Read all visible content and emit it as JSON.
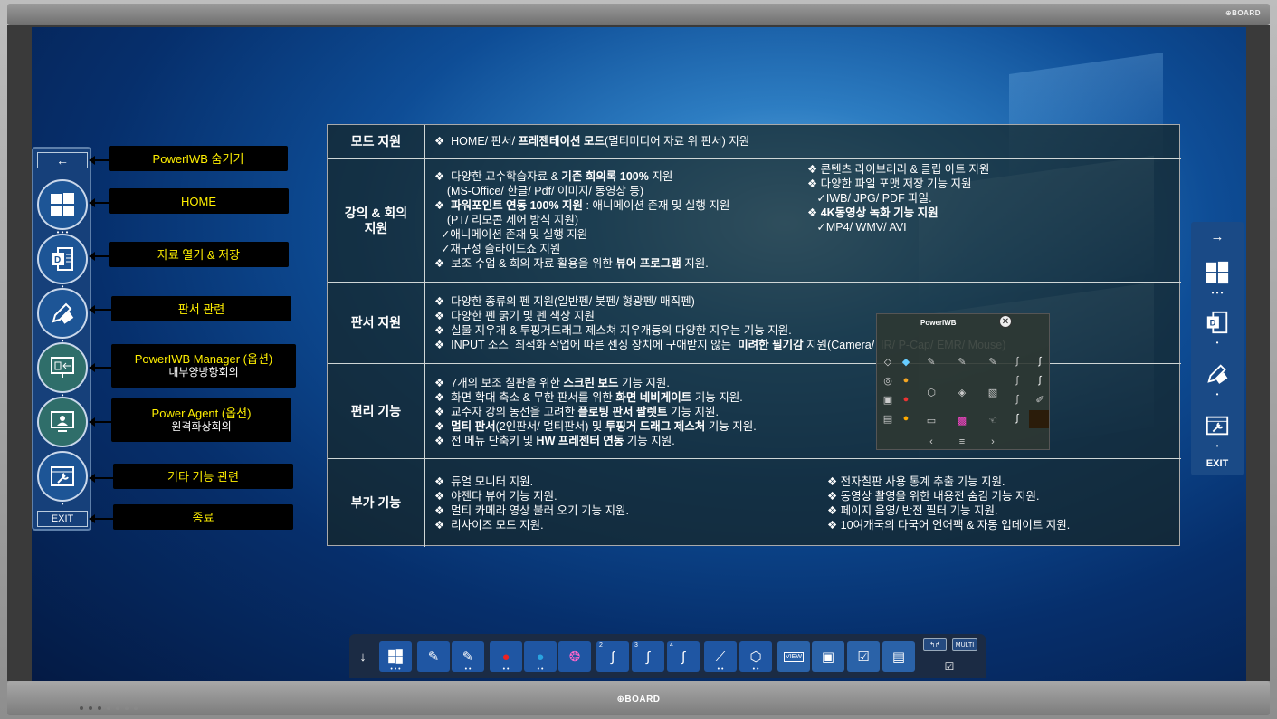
{
  "brand": "BOARD",
  "left_panel": {
    "back": "←",
    "exit": "EXIT"
  },
  "callouts": [
    {
      "title": "PowerIWB 숨기기",
      "sub": ""
    },
    {
      "title": "HOME",
      "sub": ""
    },
    {
      "title": "자료  열기 & 저장",
      "sub": ""
    },
    {
      "title": "판서 관련",
      "sub": ""
    },
    {
      "title": "PowerIWB Manager (옵션)",
      "sub": "내부양방향회의"
    },
    {
      "title": "Power Agent (옵션)",
      "sub": "원격화상회의"
    },
    {
      "title": "기타 기능 관련",
      "sub": ""
    },
    {
      "title": "종료",
      "sub": ""
    }
  ],
  "right_panel": {
    "arrow": "→",
    "exit": "EXIT"
  },
  "table": {
    "rows": [
      {
        "category": "모드 지원",
        "lines": [
          "❖  HOME/ 판서/ <b>프레젠테이션 모드</b>(멀티미디어 자료 위 판서) 지원"
        ]
      },
      {
        "category": "강의 & 회의\n지원",
        "lines": [
          "❖  다양한 교수학습자료 & <b>기존 회의록 100%</b> 지원",
          "    (MS-Office/ 한글/ Pdf/ 이미지/ 동영상 등)",
          "❖  <b>파워포인트 연동 100% 지원</b> : 애니메이션 존재 및 실행 지원",
          "    (PT/ 리모콘 제어 방식 지원)",
          "  ✓애니메이션 존재 및 실행 지원",
          "  ✓재구성 슬라이드쇼 지원",
          "❖  보조 수업 & 회의 자료 활용을 위한 <b>뷰어 프로그램</b> 지원."
        ],
        "lines_right": [
          "❖ 콘텐츠 라이브러리 & 클립 아트 지원",
          "❖ 다양한 파일 포맷 저장 기능 지원",
          "   ✓IWB/ JPG/ PDF 파일.",
          "❖ <b>4K동영상 녹화 기능 지원</b>",
          "   ✓MP4/ WMV/ AVI"
        ]
      },
      {
        "category": "판서 지원",
        "lines": [
          "❖  다양한 종류의 펜 지원(일반펜/ 붓펜/ 형광펜/ 매직펜)",
          "❖  다양한 펜 굵기 및 펜 색상 지원",
          "❖  실물 지우개 & 투핑거드래그 제스쳐 지우개등의 다양한 지우는 기능 지원.",
          "❖  INPUT 소스  최적화 작업에 따른 센싱 장치에 구애받지 않는  <b>미려한 필기감</b> 지원(Camera/  IR/ P-Cap/ EMR/ Mouse)"
        ]
      },
      {
        "category": "편리 기능",
        "lines": [
          "❖  7개의 보조 칠판을 위한 <b>스크린 보드</b> 기능 지원.",
          "❖  화면 확대 축소 & 무한 판서를 위한 <b>화면 네비게이트</b> 기능 지원.",
          "❖  교수자 강의 동선을 고려한 <b>플로팅 판서 팔렛트</b> 기능 지원.",
          "❖  <b>멀티 판서</b>(2인판서/ 멀티판서) 및 <b>투핑거 드래그 제스처</b> 기능 지원.",
          "❖  전 메뉴 단축키 및 <b>HW 프레젠터 연동</b> 기능 지원."
        ]
      },
      {
        "category": "부가 기능",
        "lines": [
          "❖  듀얼 모니터 지원.",
          "❖  야젠다 뷰어 기능 지원.",
          "❖  멀티 카메라 영상 불러 오기 기능 지원.",
          "❖  리사이즈 모드 지원."
        ],
        "lines_right": [
          "❖ 전자칠판 사용 통계 추출 기능 지원.",
          "❖ 동영상 촬영을 위한 내용전 숨김 기능 지원.",
          "❖ 페이지 음영/ 반전 필터 기능 지원.",
          "❖ 10여개국의 다국어 언어팩 & 자동 업데이트 지원."
        ]
      }
    ]
  },
  "palette": {
    "title": "PowerIWB",
    "close": "✕"
  },
  "toolbar": {
    "down": "↓",
    "multi": "MULTI",
    "nums": [
      "2",
      "3",
      "4"
    ],
    "view": "VIEW"
  }
}
